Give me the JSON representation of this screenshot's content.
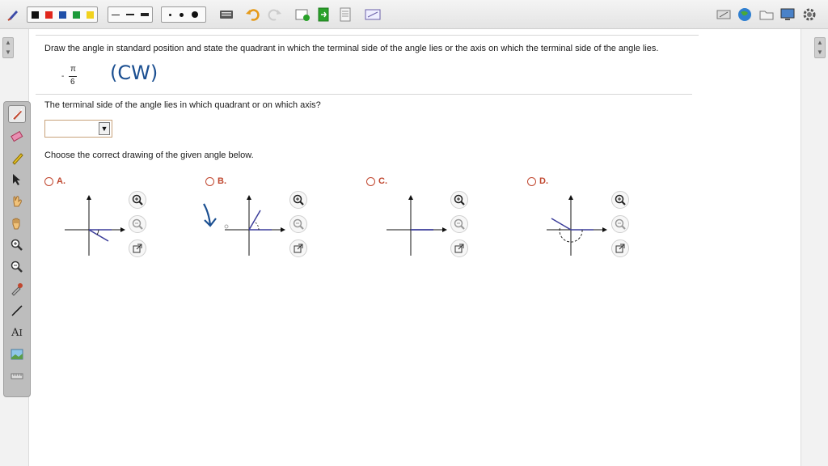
{
  "question": {
    "prompt": "Draw the angle in standard position and state the quadrant in which the terminal side of the angle lies or the axis on which the terminal side of the angle lies.",
    "angle": {
      "negative": "-",
      "numerator": "π",
      "denominator": "6"
    },
    "handwritten_note": "(CW)",
    "part1": "The terminal side of the angle lies in which quadrant or on which axis?",
    "dropdown": {
      "value": "",
      "arrow": "▼"
    },
    "part2": "Choose the correct drawing of the given angle below."
  },
  "options": [
    {
      "label": "A."
    },
    {
      "label": "B."
    },
    {
      "label": "C."
    },
    {
      "label": "D."
    }
  ],
  "colors": {
    "accent": "#c0472f",
    "ray": "#3b3d9a",
    "ink": "#1b4f91"
  },
  "icons": {
    "zoom_in": "zoom-in-icon",
    "zoom_out": "zoom-out-icon",
    "popout": "popout-icon"
  }
}
